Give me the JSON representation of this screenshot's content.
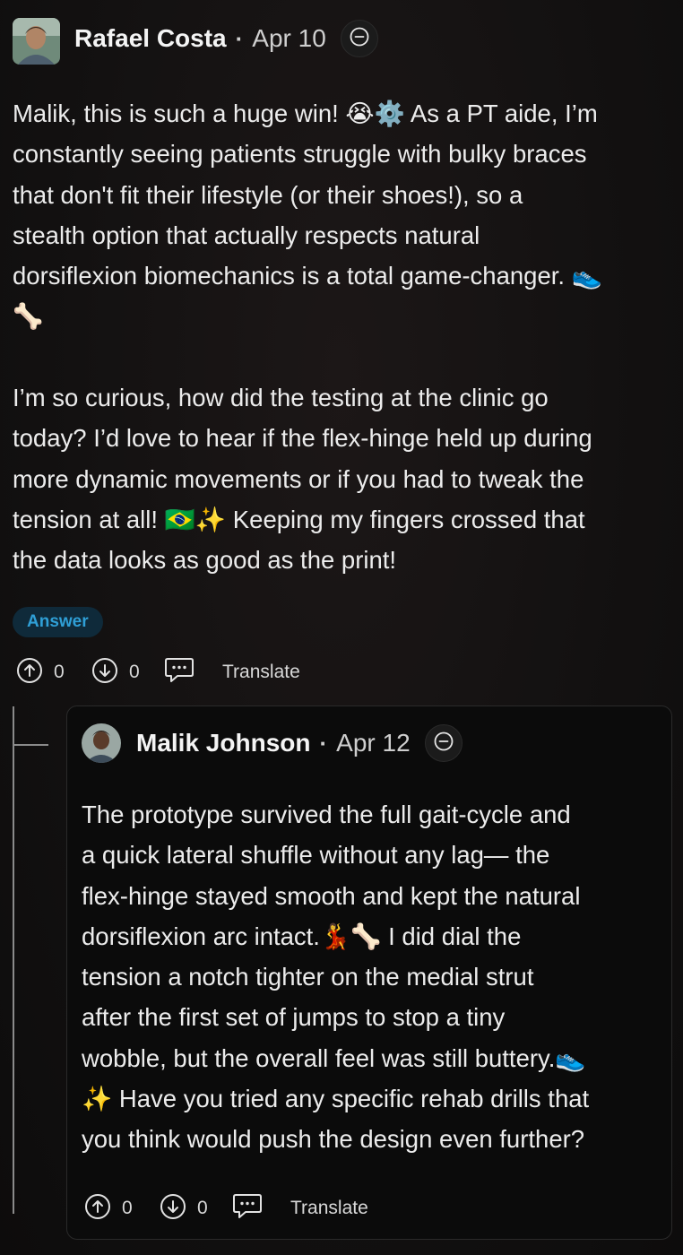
{
  "comment": {
    "author": "Rafael Costa",
    "date": "Apr 10",
    "body": "Malik, this is such a huge win! 😭⚙️ As a PT aide, I’m\nconstantly seeing patients struggle with bulky braces\nthat don't fit their lifestyle (or their shoes!), so a\nstealth option that actually respects natural\ndorsiflexion biomechanics is a total game-changer. 👟\n🦴\n\nI’m so curious, how did the testing at the clinic go\ntoday? I’d love to hear if the flex-hinge held up during\nmore dynamic movements or if you had to tweak the\ntension at all! 🇧🇷✨ Keeping my fingers crossed that\nthe data looks as good as the print!",
    "badge": "Answer",
    "upvotes": "0",
    "downvotes": "0",
    "translate_label": "Translate"
  },
  "reply": {
    "author": "Malik Johnson",
    "date": "Apr 12",
    "body": "The prototype survived the full gait-cycle and\na quick lateral shuffle without any lag— the\nflex-hinge stayed smooth and kept the natural\ndorsiflexion arc intact.💃🦴 I did dial the\ntension a notch tighter on the medial strut\nafter the first set of jumps to stop a tiny\nwobble, but the overall feel was still buttery.👟\n✨ Have you tried any specific rehab drills that\nyou think would push the design even further?",
    "upvotes": "0",
    "downvotes": "0",
    "translate_label": "Translate"
  },
  "icons": {
    "more": "minus-circle-icon",
    "upvote": "arrow-up-circle-icon",
    "downvote": "arrow-down-circle-icon",
    "reply": "speech-bubble-icon"
  },
  "colors": {
    "background": "#131111",
    "badge_bg": "#0f2a3a",
    "badge_text": "#2f9fd6",
    "text": "#ececec"
  }
}
